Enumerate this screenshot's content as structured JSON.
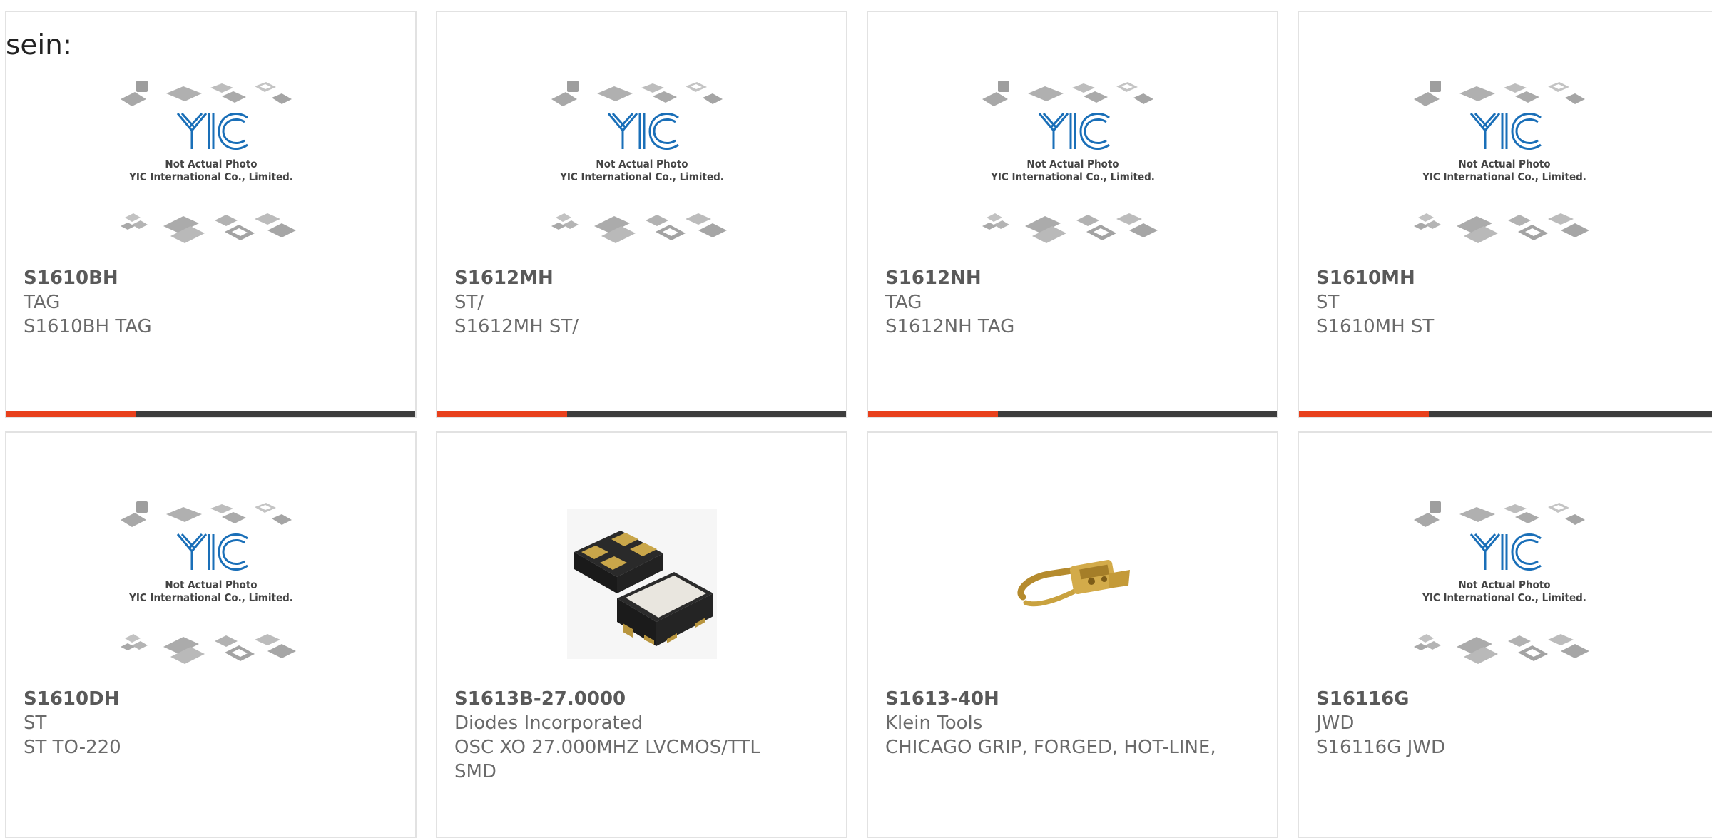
{
  "intro_text": "sein:",
  "placeholder": {
    "line1": "Not Actual Photo",
    "line2": "YIC International Co., Limited."
  },
  "colors": {
    "accent": "#e8401c",
    "bar": "#3d3d3d",
    "logo_blue": "#1a6fb8",
    "border": "#e2e2e2"
  },
  "products": [
    {
      "part": "S1610BH",
      "maker": "TAG",
      "desc": "S1610BH TAG",
      "image": "yic-placeholder"
    },
    {
      "part": "S1612MH",
      "maker": "ST/",
      "desc": "S1612MH ST/",
      "image": "yic-placeholder"
    },
    {
      "part": "S1612NH",
      "maker": "TAG",
      "desc": "S1612NH TAG",
      "image": "yic-placeholder"
    },
    {
      "part": "S1610MH",
      "maker": "ST",
      "desc": "S1610MH ST",
      "image": "yic-placeholder"
    },
    {
      "part": "S1610DH",
      "maker": "ST",
      "desc": "ST TO-220",
      "image": "yic-placeholder"
    },
    {
      "part": "S1613B-27.0000",
      "maker": "Diodes Incorporated",
      "desc": "OSC XO 27.000MHZ LVCMOS/TTL SMD",
      "image": "oscillator-photo"
    },
    {
      "part": "S1613-40H",
      "maker": "Klein Tools",
      "desc": "CHICAGO GRIP, FORGED, HOT-LINE,",
      "image": "grip-tool-photo"
    },
    {
      "part": "S16116G",
      "maker": "JWD",
      "desc": "S16116G JWD",
      "image": "yic-placeholder"
    }
  ]
}
